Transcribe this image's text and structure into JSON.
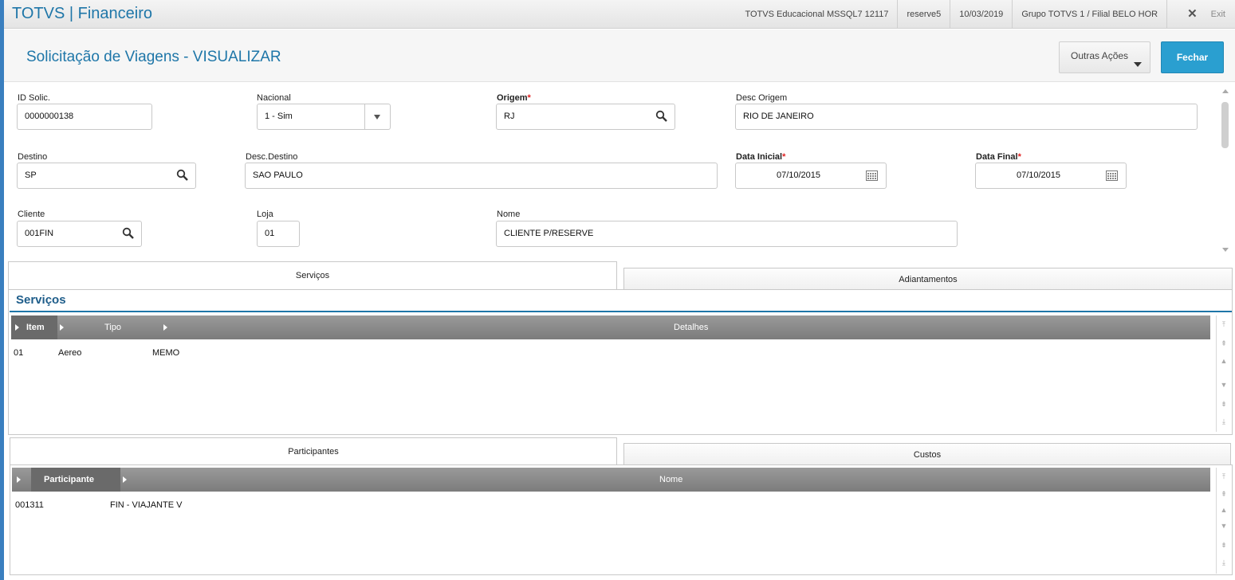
{
  "topbar": {
    "app_title": "TOTVS | Financeiro",
    "environment": "TOTVS Educacional MSSQL7 12117",
    "user": "reserve5",
    "date": "10/03/2019",
    "company": "Grupo TOTVS 1 / Filial BELO HOR",
    "exit_label": "Exit"
  },
  "header": {
    "title": "Solicitação de Viagens - VISUALIZAR",
    "other_actions_label": "Outras Ações",
    "close_label": "Fechar"
  },
  "form": {
    "id_solic": {
      "label": "ID Solic.",
      "value": "0000000138"
    },
    "nacional": {
      "label": "Nacional",
      "value": "1 - Sim"
    },
    "origem": {
      "label": "Origem",
      "required_mark": "*",
      "value": "RJ"
    },
    "desc_origem": {
      "label": "Desc Origem",
      "value": "RIO DE JANEIRO"
    },
    "destino": {
      "label": "Destino",
      "value": "SP"
    },
    "desc_destino": {
      "label": "Desc.Destino",
      "value": "SAO PAULO"
    },
    "data_inicial": {
      "label": "Data Inicial",
      "required_mark": "*",
      "value": "07/10/2015"
    },
    "data_final": {
      "label": "Data Final",
      "required_mark": "*",
      "value": "07/10/2015"
    },
    "cliente": {
      "label": "Cliente",
      "value": "001FIN"
    },
    "loja": {
      "label": "Loja",
      "value": "01"
    },
    "nome": {
      "label": "Nome",
      "value": "CLIENTE P/RESERVE"
    }
  },
  "tabs_top": [
    "Serviços",
    "Adiantamentos"
  ],
  "services": {
    "section_title": "Serviços",
    "columns": [
      "Item",
      "Tipo",
      "Detalhes"
    ],
    "rows": [
      {
        "item": "01",
        "tipo": "Aereo",
        "detalhes": "MEMO"
      }
    ]
  },
  "tabs_bottom": [
    "Participantes",
    "Custos"
  ],
  "participants": {
    "columns": [
      "Participante",
      "Nome"
    ],
    "rows": [
      {
        "participante": "001311",
        "nome": "FIN - VIAJANTE V"
      }
    ]
  },
  "colors": {
    "accent": "#1e76a8",
    "primary_button": "#2a9fd0",
    "required": "#e02020",
    "grid_header": "#8a8a8a"
  }
}
